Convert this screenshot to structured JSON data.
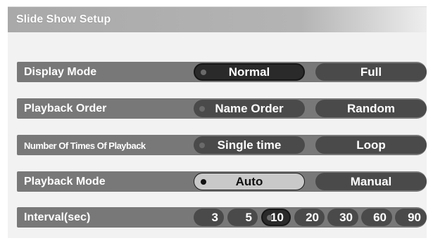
{
  "header": {
    "title": "Slide Show Setup"
  },
  "rows": [
    {
      "label": "Display Mode",
      "options": [
        "Normal",
        "Full"
      ],
      "selected": "Normal"
    },
    {
      "label": "Playback Order",
      "options": [
        "Name Order",
        "Random"
      ],
      "selected": "Name Order"
    },
    {
      "label": "Number Of Times Of Playback",
      "options": [
        "Single time",
        "Loop"
      ],
      "selected": "Single time"
    },
    {
      "label": "Playback Mode",
      "options": [
        "Auto",
        "Manual"
      ],
      "selected": "Auto"
    },
    {
      "label": "Interval(sec)",
      "options": [
        "3",
        "5",
        "10",
        "20",
        "30",
        "60",
        "90"
      ],
      "selected": "10"
    }
  ],
  "colors": {
    "row_bg": "#787878",
    "option_bg": "#4a4a4a",
    "highlight_bg": "#c9c9c9",
    "panel_bg": "#f2f2f2"
  }
}
